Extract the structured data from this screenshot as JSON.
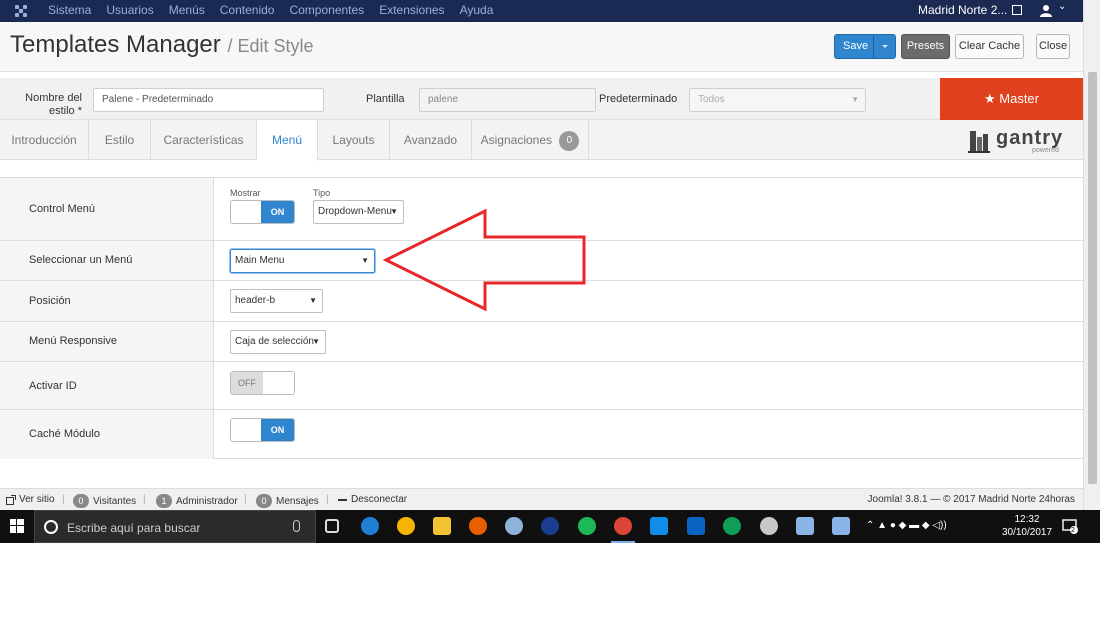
{
  "adminbar": {
    "menu": [
      "Sistema",
      "Usuarios",
      "Menús",
      "Contenido",
      "Componentes",
      "Extensiones",
      "Ayuda"
    ],
    "site_name": "Madrid Norte 2...",
    "user_caret": "⌄"
  },
  "header": {
    "title": "Templates Manager",
    "subtitle": "/ Edit Style",
    "save_label": "Save",
    "presets_label": "Presets",
    "clear_cache_label": "Clear Cache",
    "close_label": "Close"
  },
  "style": {
    "name_label": "Nombre del estilo *",
    "name_value": "Palene - Predeterminado",
    "template_label": "Plantilla",
    "template_value": "palene",
    "default_label": "Predeterminado",
    "default_value": "Todos",
    "master_label": "★ Master"
  },
  "tabs": [
    {
      "label": "Introducción"
    },
    {
      "label": "Estilo"
    },
    {
      "label": "Características"
    },
    {
      "label": "Menú"
    },
    {
      "label": "Layouts"
    },
    {
      "label": "Avanzado"
    },
    {
      "label": "Asignaciones",
      "badge": "0"
    }
  ],
  "brand": {
    "name": "gantry",
    "tagline": "powered"
  },
  "settings": {
    "control_menu": {
      "label": "Control Menú",
      "show_label": "Mostrar",
      "show_value": "ON",
      "type_label": "Tipo",
      "type_value": "Dropdown-Menu"
    },
    "select_menu": {
      "label": "Seleccionar un Menú",
      "value": "Main Menu"
    },
    "position": {
      "label": "Posición",
      "value": "header-b"
    },
    "responsive": {
      "label": "Menú Responsive",
      "value": "Caja de selección"
    },
    "activate_id": {
      "label": "Activar ID",
      "value": "OFF"
    },
    "cache": {
      "label": "Caché Módulo",
      "value": "ON"
    }
  },
  "footer": {
    "view_site": "Ver sitio",
    "visitors_count": "0",
    "visitors_label": "Visitantes",
    "admins_count": "1",
    "admins_label": "Administrador",
    "messages_count": "0",
    "messages_label": "Mensajes",
    "logout_label": "Desconectar",
    "copyright": "Joomla! 3.8.1 — © 2017 Madrid Norte 24horas"
  },
  "taskbar": {
    "search_placeholder": "Escribe aquí para buscar",
    "time": "12:32",
    "date": "30/10/2017",
    "notifications": "2"
  },
  "colors": {
    "adminbar": "#1a2a52",
    "accent": "#2f86cf",
    "master": "#e0401e",
    "annotation_arrow": "#e8262b"
  }
}
